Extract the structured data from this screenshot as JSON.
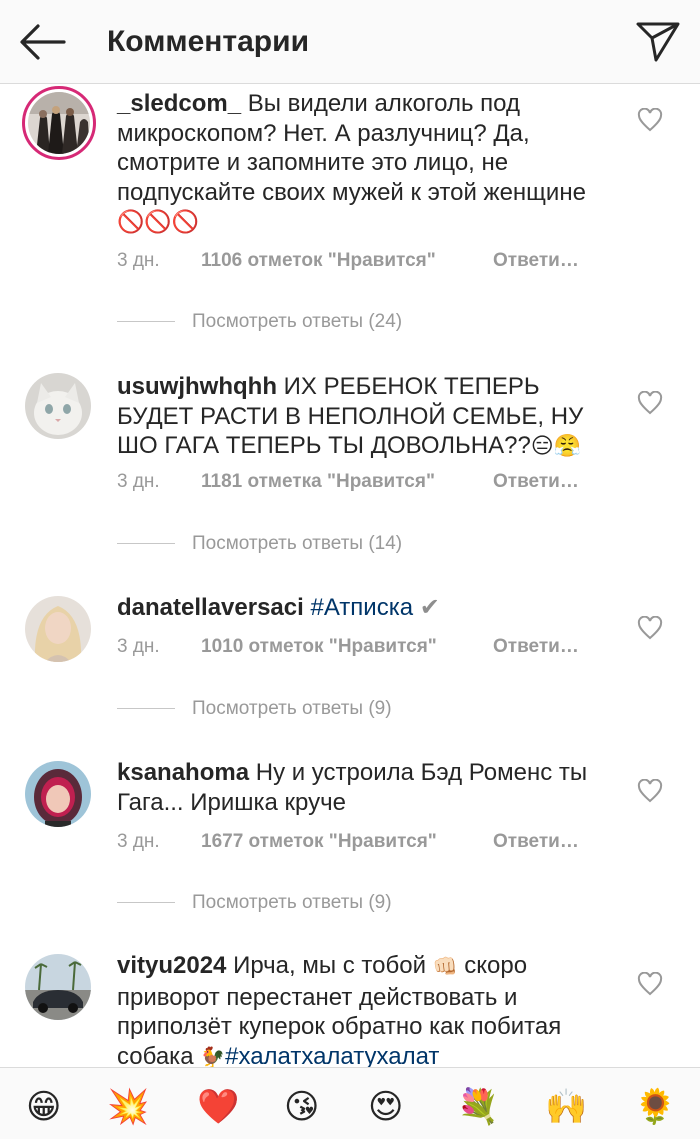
{
  "header": {
    "title": "Комментарии",
    "back_icon": "arrow-left-icon",
    "share_icon": "paper-plane-icon"
  },
  "comments": [
    {
      "username": "_sledcom_",
      "text": " Вы видели алкоголь под микроскопом? Нет. А разлучниц? Да, смотрите и запомните это лицо, не подпускайте своих мужей к этой женщине ",
      "emoji": "🚫🚫🚫",
      "time": "3 дн.",
      "likes": "1106 отметок \"Нравится\"",
      "reply": "Ответи…",
      "view_replies": "Посмотреть ответы (24)"
    },
    {
      "username": "usuwjhwhqhh",
      "text": " ИХ РЕБЕНОК ТЕПЕРЬ БУДЕТ РАСТИ В НЕПОЛНОЙ СЕМЬЕ, НУ ШО ГАГА ТЕПЕРЬ ТЫ ДОВОЛЬНА??",
      "emoji": "😑😤",
      "time": "3 дн.",
      "likes": "1181 отметка \"Нравится\"",
      "reply": "Ответи…",
      "view_replies": "Посмотреть ответы (14)"
    },
    {
      "username": "danatellaversaci",
      "hashtag": "#Атписка",
      "emoji": "✔",
      "time": "3 дн.",
      "likes": "1010 отметок \"Нравится\"",
      "reply": "Ответи…",
      "view_replies": "Посмотреть ответы (9)"
    },
    {
      "username": "ksanahoma",
      "text": " Ну и устроила Бэд Роменс ты Гага... Иришка круче",
      "time": "3 дн.",
      "likes": "1677 отметок \"Нравится\"",
      "reply": "Ответи…",
      "view_replies": "Посмотреть ответы (9)"
    },
    {
      "username": "vityu2024",
      "text_1": " Ирча, мы с тобой ",
      "emoji_1": "👊🏻",
      "text_2": " скоро приворот перестанет действовать и приползёт куперок обратно как побитая собака ",
      "emoji_2": "🐓",
      "hashtag": "#халатхалатухалат"
    }
  ],
  "emoji_bar": [
    "😁",
    "💥",
    "❤️",
    "😘",
    "😍",
    "💐",
    "🙌",
    "🌻"
  ],
  "colors": {
    "link": "#003569",
    "meta": "#999999",
    "story_ring": "#d62976"
  }
}
